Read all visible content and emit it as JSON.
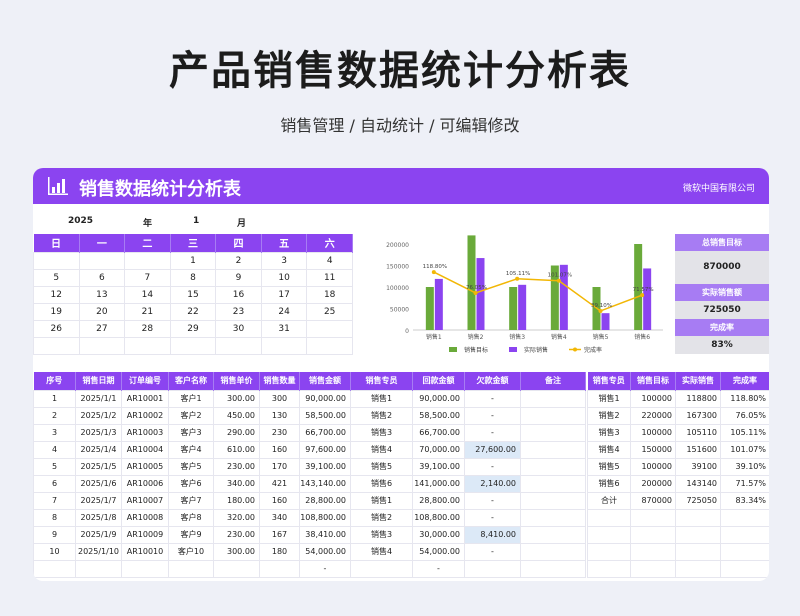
{
  "page": {
    "title": "产品销售数据统计分析表",
    "subtitle": "销售管理 / 自动统计 / 可编辑修改"
  },
  "header": {
    "title": "销售数据统计分析表",
    "company": "微软中国有限公司",
    "icon": "bar-chart-icon"
  },
  "calendar": {
    "year": "2025",
    "year_unit": "年",
    "month": "1",
    "month_unit": "月",
    "weekdays": [
      "日",
      "一",
      "二",
      "三",
      "四",
      "五",
      "六"
    ],
    "weeks": [
      [
        "",
        "",
        "",
        "1",
        "2",
        "3",
        "4"
      ],
      [
        "5",
        "6",
        "7",
        "8",
        "9",
        "10",
        "11"
      ],
      [
        "12",
        "13",
        "14",
        "15",
        "16",
        "17",
        "18"
      ],
      [
        "19",
        "20",
        "21",
        "22",
        "23",
        "24",
        "25"
      ],
      [
        "26",
        "27",
        "28",
        "29",
        "30",
        "31",
        ""
      ],
      [
        "",
        "",
        "",
        "",
        "",
        "",
        ""
      ]
    ]
  },
  "stats": {
    "target_label": "总销售目标",
    "target_value": "870000",
    "actual_label": "实际销售额",
    "actual_value": "725050",
    "rate_label": "完成率",
    "rate_value": "83%"
  },
  "chart_data": {
    "type": "bar",
    "categories": [
      "销售1",
      "销售2",
      "销售3",
      "销售4",
      "销售5",
      "销售6"
    ],
    "ylim": [
      0,
      200000
    ],
    "yticks": [
      "0",
      "50000",
      "100000",
      "150000",
      "200000"
    ],
    "series": [
      {
        "name": "销售目标",
        "type": "bar",
        "color": "#6aaa3a",
        "values": [
          100000,
          220000,
          100000,
          150000,
          100000,
          200000
        ]
      },
      {
        "name": "实际销售",
        "type": "bar",
        "color": "#8b44f0",
        "values": [
          118800,
          167300,
          105110,
          151600,
          39100,
          143140
        ]
      },
      {
        "name": "完成率",
        "type": "line",
        "color": "#f2b705",
        "values": [
          118.8,
          76.05,
          105.11,
          101.07,
          39.1,
          71.57
        ],
        "labels": [
          "118.80%",
          "76.05%",
          "105.11%",
          "101.07%",
          "39.10%",
          "71.57%"
        ]
      }
    ]
  },
  "orders": {
    "headers": [
      "序号",
      "销售日期",
      "订单编号",
      "客户名称",
      "销售单价",
      "销售数量",
      "销售金额",
      "销售专员",
      "回款金额",
      "欠款金额",
      "备注"
    ],
    "rows": [
      [
        "1",
        "2025/1/1",
        "AR10001",
        "客户1",
        "300.00",
        "300",
        "90,000.00",
        "销售1",
        "90,000.00",
        "-",
        ""
      ],
      [
        "2",
        "2025/1/2",
        "AR10002",
        "客户2",
        "450.00",
        "130",
        "58,500.00",
        "销售2",
        "58,500.00",
        "-",
        ""
      ],
      [
        "3",
        "2025/1/3",
        "AR10003",
        "客户3",
        "290.00",
        "230",
        "66,700.00",
        "销售3",
        "66,700.00",
        "-",
        ""
      ],
      [
        "4",
        "2025/1/4",
        "AR10004",
        "客户4",
        "610.00",
        "160",
        "97,600.00",
        "销售4",
        "70,000.00",
        "27,600.00",
        ""
      ],
      [
        "5",
        "2025/1/5",
        "AR10005",
        "客户5",
        "230.00",
        "170",
        "39,100.00",
        "销售5",
        "39,100.00",
        "-",
        ""
      ],
      [
        "6",
        "2025/1/6",
        "AR10006",
        "客户6",
        "340.00",
        "421",
        "143,140.00",
        "销售6",
        "141,000.00",
        "2,140.00",
        ""
      ],
      [
        "7",
        "2025/1/7",
        "AR10007",
        "客户7",
        "180.00",
        "160",
        "28,800.00",
        "销售1",
        "28,800.00",
        "-",
        ""
      ],
      [
        "8",
        "2025/1/8",
        "AR10008",
        "客户8",
        "320.00",
        "340",
        "108,800.00",
        "销售2",
        "108,800.00",
        "-",
        ""
      ],
      [
        "9",
        "2025/1/9",
        "AR10009",
        "客户9",
        "230.00",
        "167",
        "38,410.00",
        "销售3",
        "30,000.00",
        "8,410.00",
        ""
      ],
      [
        "10",
        "2025/1/10",
        "AR10010",
        "客户10",
        "300.00",
        "180",
        "54,000.00",
        "销售4",
        "54,000.00",
        "-",
        ""
      ],
      [
        "",
        "",
        "",
        "",
        "",
        "",
        "-",
        "",
        "-",
        "",
        ""
      ]
    ]
  },
  "summary": {
    "headers": [
      "销售专员",
      "销售目标",
      "实际销售",
      "完成率"
    ],
    "rows": [
      [
        "销售1",
        "100000",
        "118800",
        "118.80%"
      ],
      [
        "销售2",
        "220000",
        "167300",
        "76.05%"
      ],
      [
        "销售3",
        "100000",
        "105110",
        "105.11%"
      ],
      [
        "销售4",
        "150000",
        "151600",
        "101.07%"
      ],
      [
        "销售5",
        "100000",
        "39100",
        "39.10%"
      ],
      [
        "销售6",
        "200000",
        "143140",
        "71.57%"
      ],
      [
        "合计",
        "870000",
        "725050",
        "83.34%"
      ],
      [
        "",
        "",
        "",
        ""
      ],
      [
        "",
        "",
        "",
        ""
      ],
      [
        "",
        "",
        "",
        ""
      ],
      [
        "",
        "",
        "",
        ""
      ]
    ]
  }
}
